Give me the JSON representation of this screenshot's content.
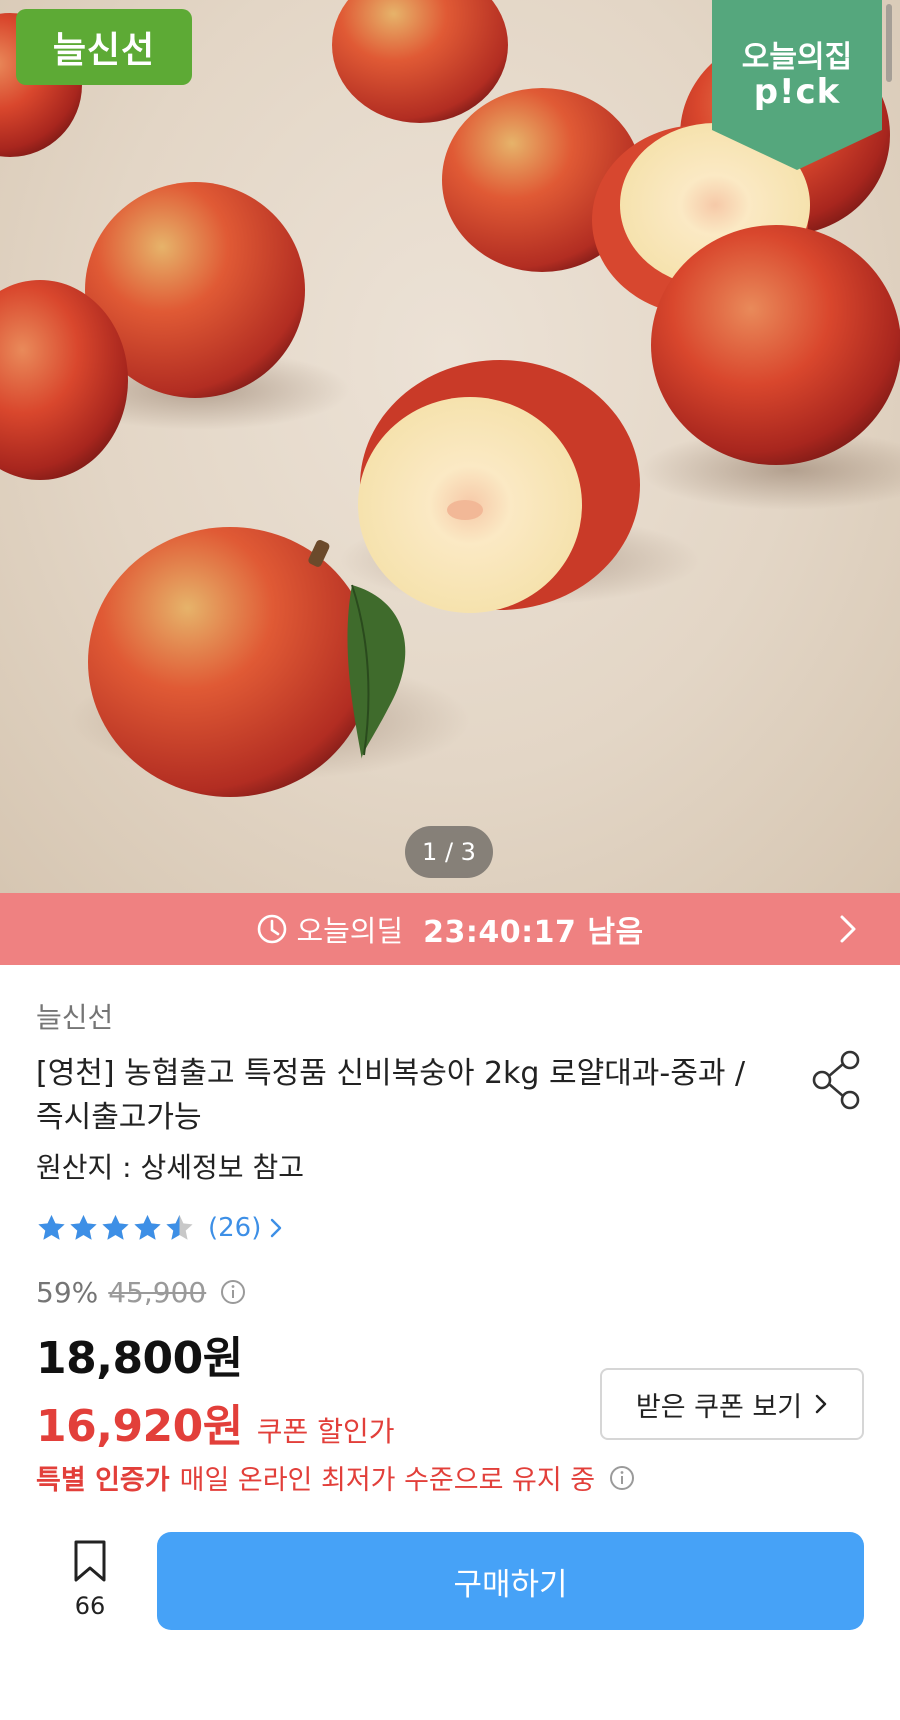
{
  "hero": {
    "brand_badge": "늘신선",
    "pick_line1": "오늘의집",
    "pick_line2": "p!ck",
    "page_indicator": "1 / 3",
    "image_icon": "peach-photo"
  },
  "deal_banner": {
    "label": "오늘의딜",
    "timer": "23:40:17 남음",
    "clock_icon": "clock-icon",
    "arrow_icon": "chevron-right-icon"
  },
  "product": {
    "seller": "늘신선",
    "title": "[영천] 농협출고 특정품 신비복숭아 2kg 로얄대과-중과 / 즉시출고가능",
    "origin": "원산지 : 상세정보 참고",
    "rating": {
      "value": 4.5,
      "max": 5,
      "review_count": "(26)"
    },
    "discount_percent": "59%",
    "original_price": "45,900",
    "price": "18,800원",
    "coupon_price": "16,920원",
    "coupon_price_label": "쿠폰 할인가",
    "coupon_button": "받은 쿠폰 보기",
    "special_tag": "특별 인증가",
    "special_text": "매일 온라인 최저가 수준으로 유지 중"
  },
  "bottom_bar": {
    "bookmark_count": "66",
    "buy_label": "구매하기"
  },
  "colors": {
    "brand_green": "#5daa35",
    "pick_green": "#55a77d",
    "deal_banner": "#ef8181",
    "sale_red": "#e23f3a",
    "star_blue": "#3d8fe6",
    "buy_blue": "#46a2f7"
  }
}
